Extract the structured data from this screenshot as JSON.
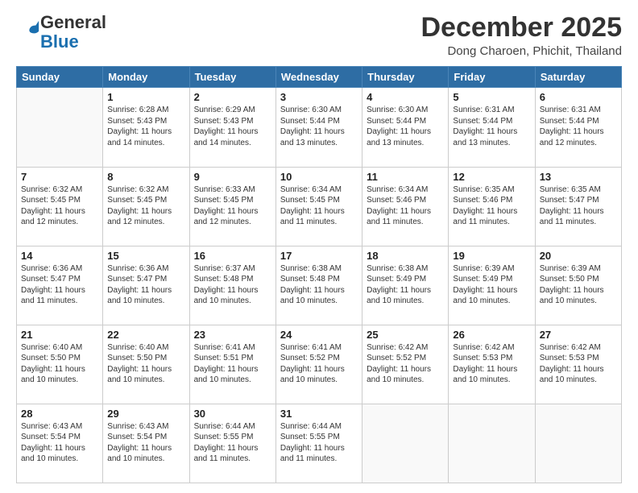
{
  "header": {
    "logo_general": "General",
    "logo_blue": "Blue",
    "month_year": "December 2025",
    "location": "Dong Charoen, Phichit, Thailand"
  },
  "weekdays": [
    "Sunday",
    "Monday",
    "Tuesday",
    "Wednesday",
    "Thursday",
    "Friday",
    "Saturday"
  ],
  "weeks": [
    [
      {
        "day": "",
        "sunrise": "",
        "sunset": "",
        "daylight": ""
      },
      {
        "day": "1",
        "sunrise": "6:28 AM",
        "sunset": "5:43 PM",
        "daylight": "11 hours and 14 minutes."
      },
      {
        "day": "2",
        "sunrise": "6:29 AM",
        "sunset": "5:43 PM",
        "daylight": "11 hours and 14 minutes."
      },
      {
        "day": "3",
        "sunrise": "6:30 AM",
        "sunset": "5:44 PM",
        "daylight": "11 hours and 13 minutes."
      },
      {
        "day": "4",
        "sunrise": "6:30 AM",
        "sunset": "5:44 PM",
        "daylight": "11 hours and 13 minutes."
      },
      {
        "day": "5",
        "sunrise": "6:31 AM",
        "sunset": "5:44 PM",
        "daylight": "11 hours and 13 minutes."
      },
      {
        "day": "6",
        "sunrise": "6:31 AM",
        "sunset": "5:44 PM",
        "daylight": "11 hours and 12 minutes."
      }
    ],
    [
      {
        "day": "7",
        "sunrise": "6:32 AM",
        "sunset": "5:45 PM",
        "daylight": "11 hours and 12 minutes."
      },
      {
        "day": "8",
        "sunrise": "6:32 AM",
        "sunset": "5:45 PM",
        "daylight": "11 hours and 12 minutes."
      },
      {
        "day": "9",
        "sunrise": "6:33 AM",
        "sunset": "5:45 PM",
        "daylight": "11 hours and 12 minutes."
      },
      {
        "day": "10",
        "sunrise": "6:34 AM",
        "sunset": "5:45 PM",
        "daylight": "11 hours and 11 minutes."
      },
      {
        "day": "11",
        "sunrise": "6:34 AM",
        "sunset": "5:46 PM",
        "daylight": "11 hours and 11 minutes."
      },
      {
        "day": "12",
        "sunrise": "6:35 AM",
        "sunset": "5:46 PM",
        "daylight": "11 hours and 11 minutes."
      },
      {
        "day": "13",
        "sunrise": "6:35 AM",
        "sunset": "5:47 PM",
        "daylight": "11 hours and 11 minutes."
      }
    ],
    [
      {
        "day": "14",
        "sunrise": "6:36 AM",
        "sunset": "5:47 PM",
        "daylight": "11 hours and 11 minutes."
      },
      {
        "day": "15",
        "sunrise": "6:36 AM",
        "sunset": "5:47 PM",
        "daylight": "11 hours and 10 minutes."
      },
      {
        "day": "16",
        "sunrise": "6:37 AM",
        "sunset": "5:48 PM",
        "daylight": "11 hours and 10 minutes."
      },
      {
        "day": "17",
        "sunrise": "6:38 AM",
        "sunset": "5:48 PM",
        "daylight": "11 hours and 10 minutes."
      },
      {
        "day": "18",
        "sunrise": "6:38 AM",
        "sunset": "5:49 PM",
        "daylight": "11 hours and 10 minutes."
      },
      {
        "day": "19",
        "sunrise": "6:39 AM",
        "sunset": "5:49 PM",
        "daylight": "11 hours and 10 minutes."
      },
      {
        "day": "20",
        "sunrise": "6:39 AM",
        "sunset": "5:50 PM",
        "daylight": "11 hours and 10 minutes."
      }
    ],
    [
      {
        "day": "21",
        "sunrise": "6:40 AM",
        "sunset": "5:50 PM",
        "daylight": "11 hours and 10 minutes."
      },
      {
        "day": "22",
        "sunrise": "6:40 AM",
        "sunset": "5:50 PM",
        "daylight": "11 hours and 10 minutes."
      },
      {
        "day": "23",
        "sunrise": "6:41 AM",
        "sunset": "5:51 PM",
        "daylight": "11 hours and 10 minutes."
      },
      {
        "day": "24",
        "sunrise": "6:41 AM",
        "sunset": "5:52 PM",
        "daylight": "11 hours and 10 minutes."
      },
      {
        "day": "25",
        "sunrise": "6:42 AM",
        "sunset": "5:52 PM",
        "daylight": "11 hours and 10 minutes."
      },
      {
        "day": "26",
        "sunrise": "6:42 AM",
        "sunset": "5:53 PM",
        "daylight": "11 hours and 10 minutes."
      },
      {
        "day": "27",
        "sunrise": "6:42 AM",
        "sunset": "5:53 PM",
        "daylight": "11 hours and 10 minutes."
      }
    ],
    [
      {
        "day": "28",
        "sunrise": "6:43 AM",
        "sunset": "5:54 PM",
        "daylight": "11 hours and 10 minutes."
      },
      {
        "day": "29",
        "sunrise": "6:43 AM",
        "sunset": "5:54 PM",
        "daylight": "11 hours and 10 minutes."
      },
      {
        "day": "30",
        "sunrise": "6:44 AM",
        "sunset": "5:55 PM",
        "daylight": "11 hours and 11 minutes."
      },
      {
        "day": "31",
        "sunrise": "6:44 AM",
        "sunset": "5:55 PM",
        "daylight": "11 hours and 11 minutes."
      },
      {
        "day": "",
        "sunrise": "",
        "sunset": "",
        "daylight": ""
      },
      {
        "day": "",
        "sunrise": "",
        "sunset": "",
        "daylight": ""
      },
      {
        "day": "",
        "sunrise": "",
        "sunset": "",
        "daylight": ""
      }
    ]
  ]
}
